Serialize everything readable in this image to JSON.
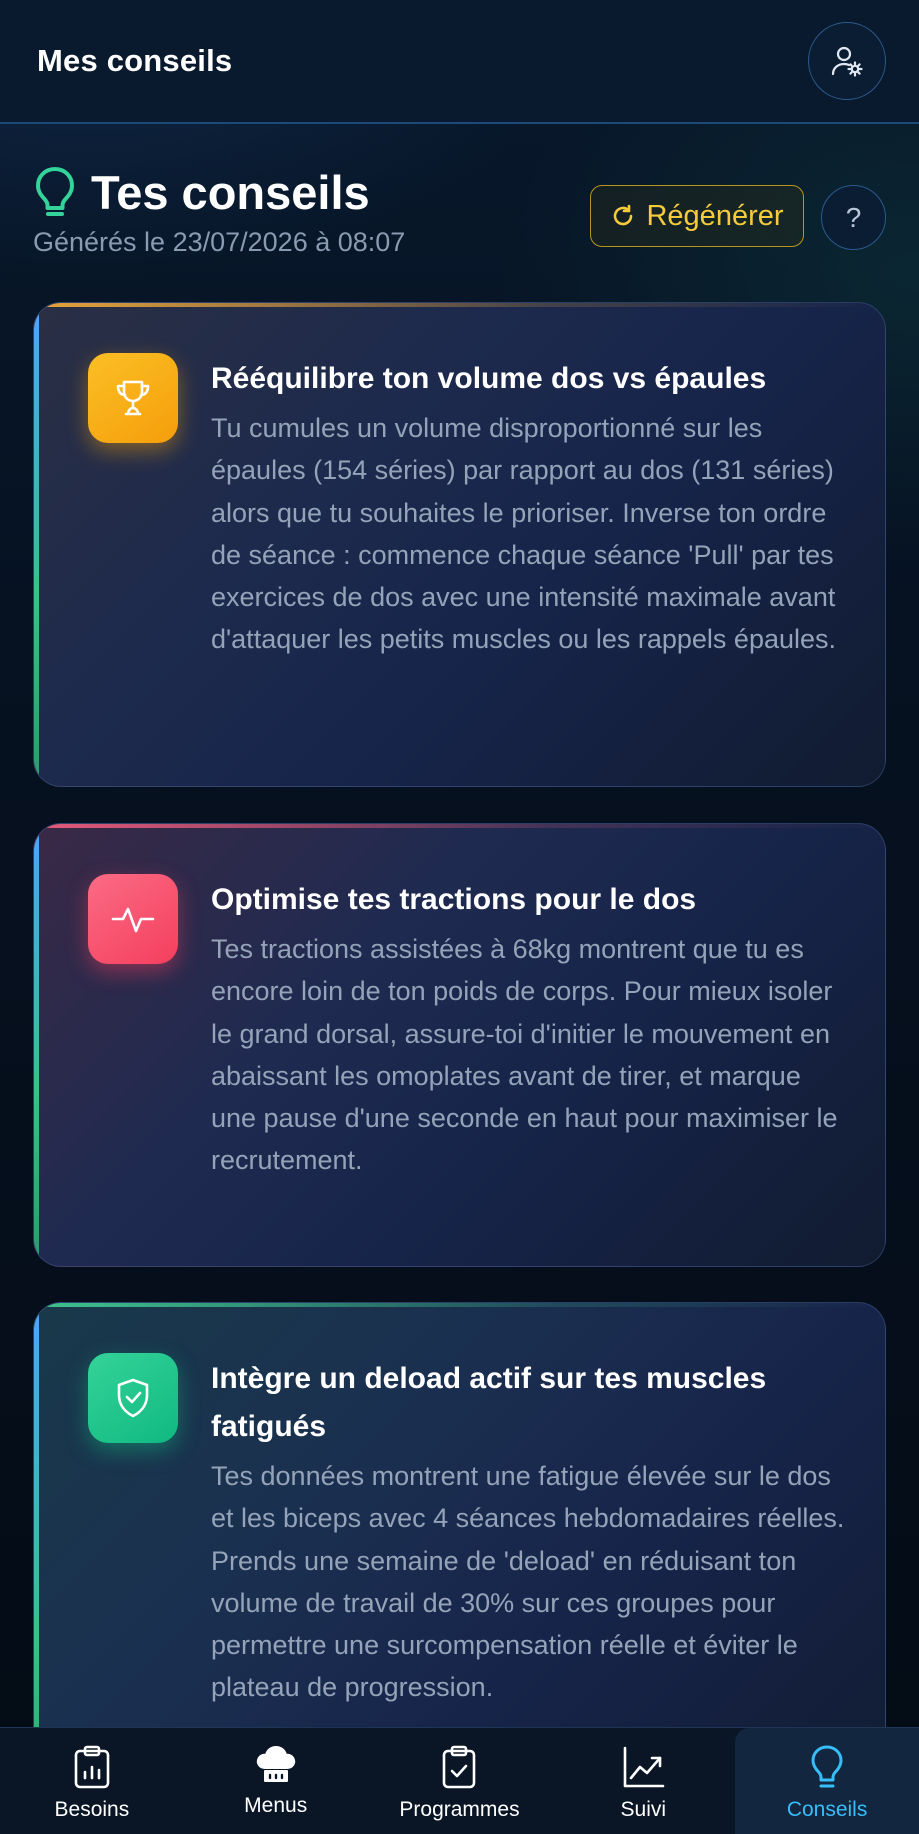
{
  "header": {
    "title": "Mes conseils",
    "profile_icon": "user-settings-icon"
  },
  "section": {
    "title": "Tes conseils",
    "generated": "Générés le 23/07/2026 à 08:07",
    "regenerate_label": "Régénérer",
    "help_label": "?"
  },
  "cards": [
    {
      "icon": "trophy-icon",
      "accent": "#f59e0b",
      "title": "Rééquilibre ton volume dos vs épaules",
      "text": "Tu cumules un volume disproportionné sur les épaules (154 séries) par rapport au dos (131 séries) alors que tu souhaites le prioriser. Inverse ton ordre de séance : commence chaque séance 'Pull' par tes exercices de dos avec une intensité maximale avant d'attaquer les petits muscles ou les rappels épaules."
    },
    {
      "icon": "activity-icon",
      "accent": "#f43f5e",
      "title": "Optimise tes tractions pour le dos",
      "text": "Tes tractions assistées à 68kg montrent que tu es encore loin de ton poids de corps. Pour mieux isoler le grand dorsal, assure-toi d'initier le mouvement en abaissant les omoplates avant de tirer, et marque une pause d'une seconde en haut pour maximiser le recrutement."
    },
    {
      "icon": "shield-check-icon",
      "accent": "#10b981",
      "title": "Intègre un deload actif sur tes muscles fatigués",
      "text": "Tes données montrent une fatigue élevée sur le dos et les biceps avec 4 séances hebdomadaires réelles. Prends une semaine de 'deload' en réduisant ton volume de travail de 30% sur ces groupes pour permettre une surcompensation réelle et éviter le plateau de progression."
    }
  ],
  "nav": {
    "items": [
      {
        "label": "Besoins",
        "icon": "clipboard-chart-icon"
      },
      {
        "label": "Menus",
        "icon": "chef-hat-icon"
      },
      {
        "label": "Programmes",
        "icon": "clipboard-check-icon"
      },
      {
        "label": "Suivi",
        "icon": "trend-chart-icon"
      },
      {
        "label": "Conseils",
        "icon": "lightbulb-icon"
      }
    ],
    "active": "Conseils"
  },
  "colors": {
    "accent_active": "#38bdf8",
    "regenerate": "#f5cb3c",
    "bulb": "#34d399"
  }
}
